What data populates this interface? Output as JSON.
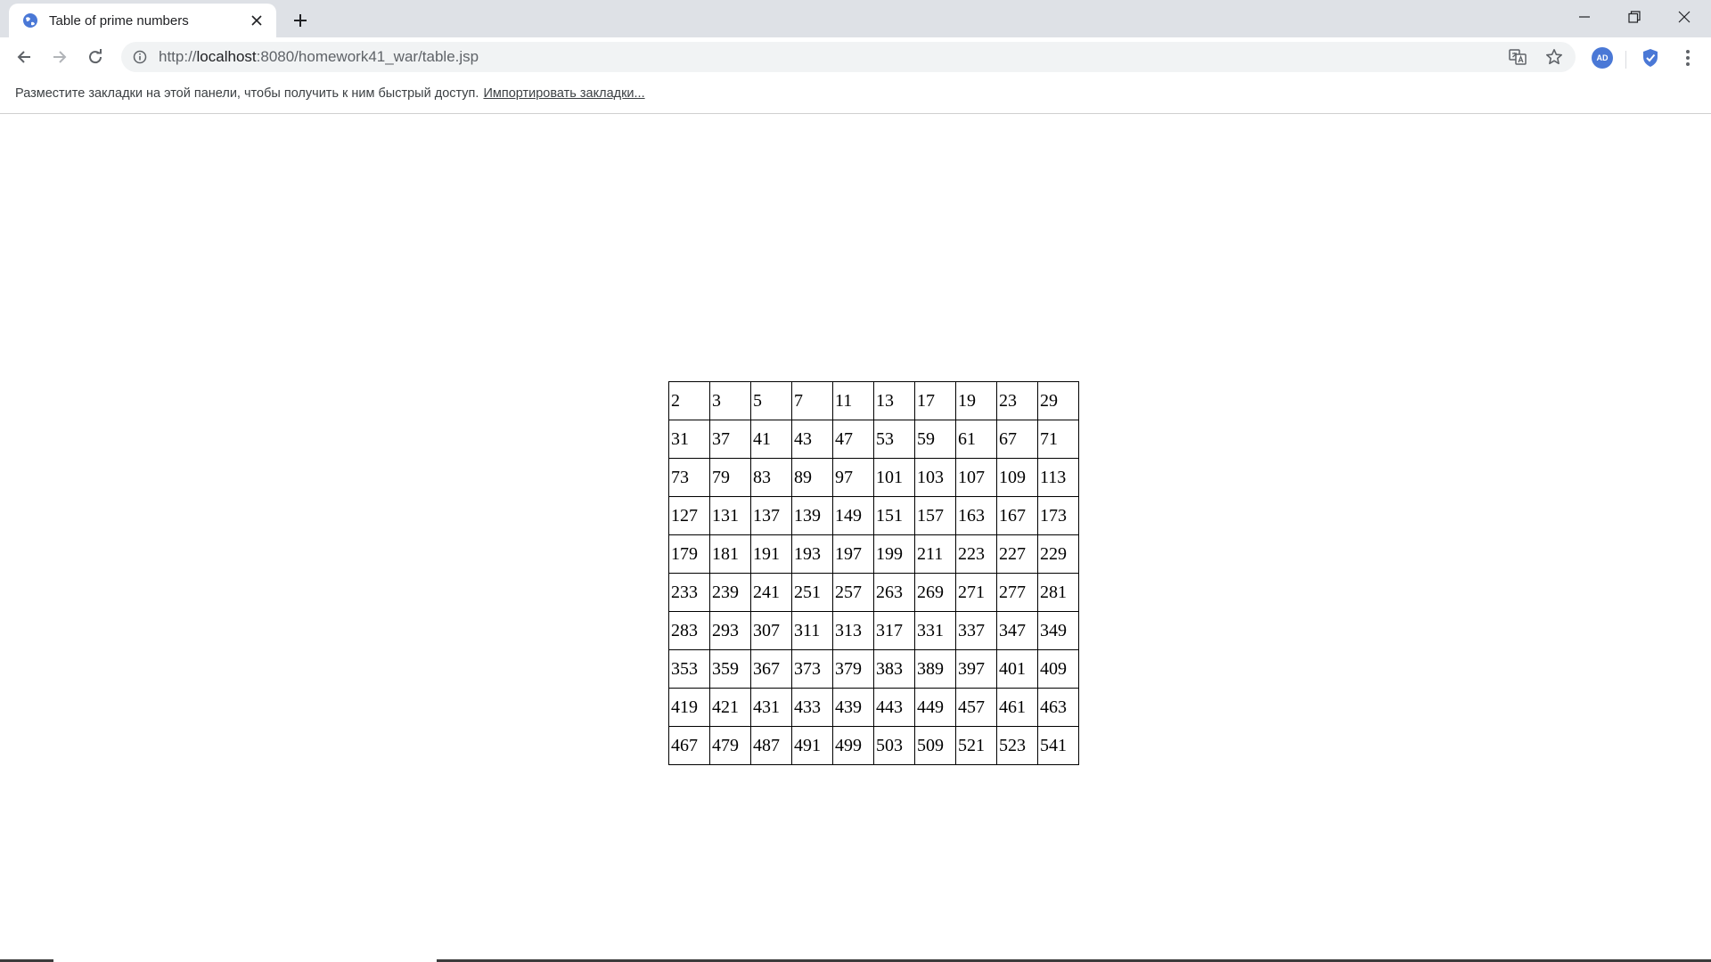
{
  "tab": {
    "title": "Table of prime numbers"
  },
  "address": {
    "prefix": "http://",
    "host": "localhost",
    "path": ":8080/homework41_war/table.jsp"
  },
  "bookmarks_bar": {
    "prompt": "Разместите закладки на этой панели, чтобы получить к ним быстрый доступ.",
    "import_link": "Импортировать закладки..."
  },
  "extensions": {
    "adblock_label": "AD"
  },
  "icons": {
    "favicon": "globe-icon",
    "tab_close": "close-icon",
    "new_tab": "plus-icon",
    "back": "arrow-left-icon",
    "forward": "arrow-right-icon",
    "reload": "reload-icon",
    "site_info": "info-icon",
    "translate": "translate-icon",
    "bookmark": "star-icon",
    "adblock": "adblock-icon",
    "shield": "shield-check-icon",
    "menu": "kebab-menu-icon",
    "minimize": "minimize-icon",
    "maximize": "restore-icon",
    "close_window": "close-window-icon"
  },
  "colors": {
    "tabstrip_bg": "#dee1e6",
    "omnibox_bg": "#f1f3f4",
    "accent_blue": "#4a78d6",
    "table_border": "#000000"
  },
  "table": {
    "rows": [
      [
        "2",
        "3",
        "5",
        "7",
        "11",
        "13",
        "17",
        "19",
        "23",
        "29"
      ],
      [
        "31",
        "37",
        "41",
        "43",
        "47",
        "53",
        "59",
        "61",
        "67",
        "71"
      ],
      [
        "73",
        "79",
        "83",
        "89",
        "97",
        "101",
        "103",
        "107",
        "109",
        "113"
      ],
      [
        "127",
        "131",
        "137",
        "139",
        "149",
        "151",
        "157",
        "163",
        "167",
        "173"
      ],
      [
        "179",
        "181",
        "191",
        "193",
        "197",
        "199",
        "211",
        "223",
        "227",
        "229"
      ],
      [
        "233",
        "239",
        "241",
        "251",
        "257",
        "263",
        "269",
        "271",
        "277",
        "281"
      ],
      [
        "283",
        "293",
        "307",
        "311",
        "313",
        "317",
        "331",
        "337",
        "347",
        "349"
      ],
      [
        "353",
        "359",
        "367",
        "373",
        "379",
        "383",
        "389",
        "397",
        "401",
        "409"
      ],
      [
        "419",
        "421",
        "431",
        "433",
        "439",
        "443",
        "449",
        "457",
        "461",
        "463"
      ],
      [
        "467",
        "479",
        "487",
        "491",
        "499",
        "503",
        "509",
        "521",
        "523",
        "541"
      ]
    ]
  }
}
